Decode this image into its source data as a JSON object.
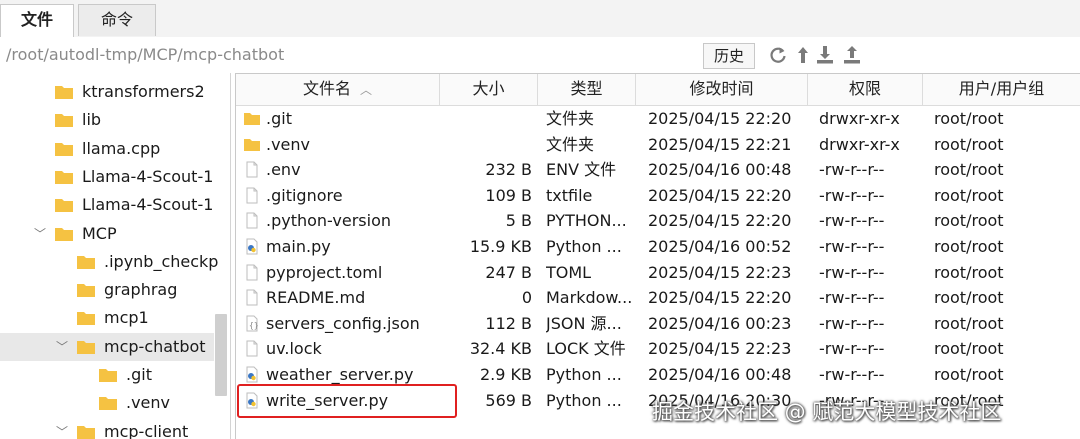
{
  "tabs": [
    {
      "label": "文件",
      "active": true
    },
    {
      "label": "命令",
      "active": false
    }
  ],
  "path": "/root/autodl-tmp/MCP/mcp-chatbot",
  "history_button": "历史",
  "toolbar_icons": [
    "refresh-icon",
    "upload-arrow-icon",
    "download-icon",
    "upload-icon"
  ],
  "tree": [
    {
      "label": "ktransformers2",
      "depth": 1
    },
    {
      "label": "lib",
      "depth": 1
    },
    {
      "label": "llama.cpp",
      "depth": 1
    },
    {
      "label": "Llama-4-Scout-1",
      "depth": 1
    },
    {
      "label": "Llama-4-Scout-1",
      "depth": 1
    },
    {
      "label": "MCP",
      "depth": 1,
      "expanded": true
    },
    {
      "label": ".ipynb_checkp",
      "depth": 2
    },
    {
      "label": "graphrag",
      "depth": 2
    },
    {
      "label": "mcp1",
      "depth": 2
    },
    {
      "label": "mcp-chatbot",
      "depth": 2,
      "expanded": true,
      "selected": true
    },
    {
      "label": ".git",
      "depth": 3
    },
    {
      "label": ".venv",
      "depth": 3
    },
    {
      "label": "mcp-client",
      "depth": 2,
      "expanded": true
    }
  ],
  "columns": {
    "name": "文件名",
    "size": "大小",
    "type": "类型",
    "modified": "修改时间",
    "perm": "权限",
    "owner": "用户/用户组"
  },
  "files": [
    {
      "name": ".git",
      "size": "",
      "type": "文件夹",
      "modified": "2025/04/15 22:20",
      "perm": "drwxr-xr-x",
      "owner": "root/root",
      "icon": "folder-icon"
    },
    {
      "name": ".venv",
      "size": "",
      "type": "文件夹",
      "modified": "2025/04/15 22:21",
      "perm": "drwxr-xr-x",
      "owner": "root/root",
      "icon": "folder-icon"
    },
    {
      "name": ".env",
      "size": "232 B",
      "type": "ENV 文件",
      "modified": "2025/04/16 00:48",
      "perm": "-rw-r--r--",
      "owner": "root/root",
      "icon": "file-icon"
    },
    {
      "name": ".gitignore",
      "size": "109 B",
      "type": "txtfile",
      "modified": "2025/04/15 22:20",
      "perm": "-rw-r--r--",
      "owner": "root/root",
      "icon": "file-icon"
    },
    {
      "name": ".python-version",
      "size": "5 B",
      "type": "PYTHON...",
      "modified": "2025/04/15 22:20",
      "perm": "-rw-r--r--",
      "owner": "root/root",
      "icon": "file-icon"
    },
    {
      "name": "main.py",
      "size": "15.9 KB",
      "type": "Python ...",
      "modified": "2025/04/16 00:52",
      "perm": "-rw-r--r--",
      "owner": "root/root",
      "icon": "python-file-icon"
    },
    {
      "name": "pyproject.toml",
      "size": "247 B",
      "type": "TOML",
      "modified": "2025/04/15 22:23",
      "perm": "-rw-r--r--",
      "owner": "root/root",
      "icon": "file-icon"
    },
    {
      "name": "README.md",
      "size": "0",
      "type": "Markdow...",
      "modified": "2025/04/15 22:20",
      "perm": "-rw-r--r--",
      "owner": "root/root",
      "icon": "file-icon"
    },
    {
      "name": "servers_config.json",
      "size": "112 B",
      "type": "JSON 源...",
      "modified": "2025/04/16 00:23",
      "perm": "-rw-r--r--",
      "owner": "root/root",
      "icon": "json-file-icon"
    },
    {
      "name": "uv.lock",
      "size": "32.4 KB",
      "type": "LOCK 文件",
      "modified": "2025/04/15 22:23",
      "perm": "-rw-r--r--",
      "owner": "root/root",
      "icon": "file-icon"
    },
    {
      "name": "weather_server.py",
      "size": "2.9 KB",
      "type": "Python ...",
      "modified": "2025/04/16 00:48",
      "perm": "-rw-r--r--",
      "owner": "root/root",
      "icon": "python-file-icon"
    },
    {
      "name": "write_server.py",
      "size": "569 B",
      "type": "Python ...",
      "modified": "2025/04/16 20:30",
      "perm": "-rw-r--r--",
      "owner": "root/root",
      "icon": "python-file-icon",
      "highlighted": true
    }
  ],
  "watermark": "掘金技术社区 @ 赋范大模型技术社区",
  "colors": {
    "folder": "#f5c242",
    "highlight": "#e02020",
    "selected_row": "#e8e8e8",
    "python_icon": "#3b77c4"
  }
}
